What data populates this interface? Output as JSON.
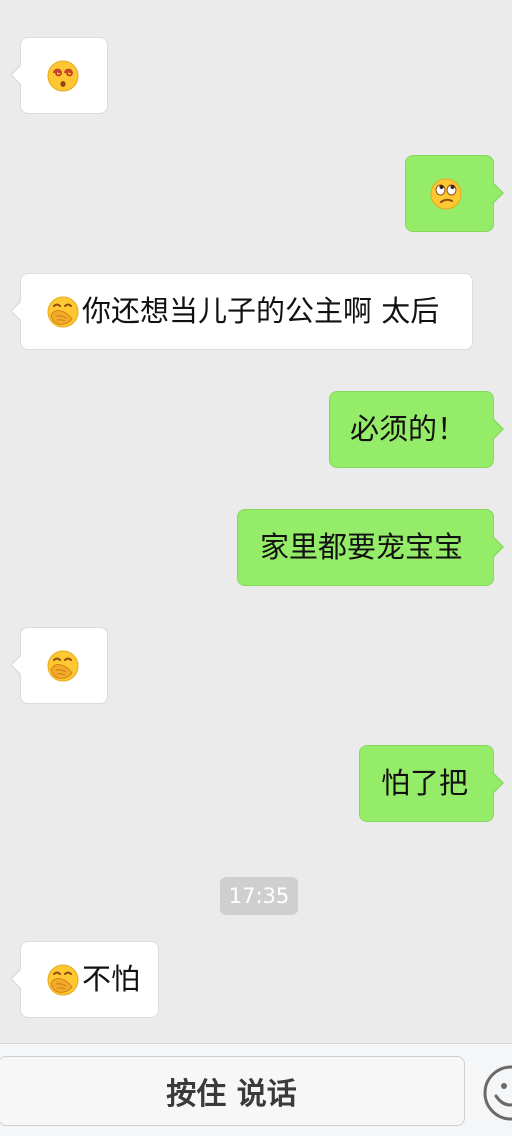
{
  "messages": [
    {
      "side": "left",
      "emoji": "dizzy-face",
      "text": ""
    },
    {
      "side": "right",
      "emoji": "rolling-eyes-face",
      "text": ""
    },
    {
      "side": "left",
      "emoji": "facepalm-face",
      "text": "你还想当儿子的公主啊 太后"
    },
    {
      "side": "right",
      "emoji": "",
      "text": "必须的！"
    },
    {
      "side": "right",
      "emoji": "",
      "text": "家里都要宠宝宝"
    },
    {
      "side": "left",
      "emoji": "facepalm-face",
      "text": ""
    },
    {
      "side": "right",
      "emoji": "",
      "text": "怕了把"
    },
    {
      "side": "left",
      "emoji": "facepalm-face",
      "text": "不怕"
    }
  ],
  "timestamp": "17:35",
  "input_bar": {
    "hold_to_talk_label": "按住 说话",
    "emoji_button_icon": "smiley-face-icon"
  },
  "colors": {
    "chat_background": "#ebebeb",
    "incoming_bubble": "#ffffff",
    "outgoing_bubble": "#95ec69",
    "timestamp_background": "#cfcfcf"
  }
}
